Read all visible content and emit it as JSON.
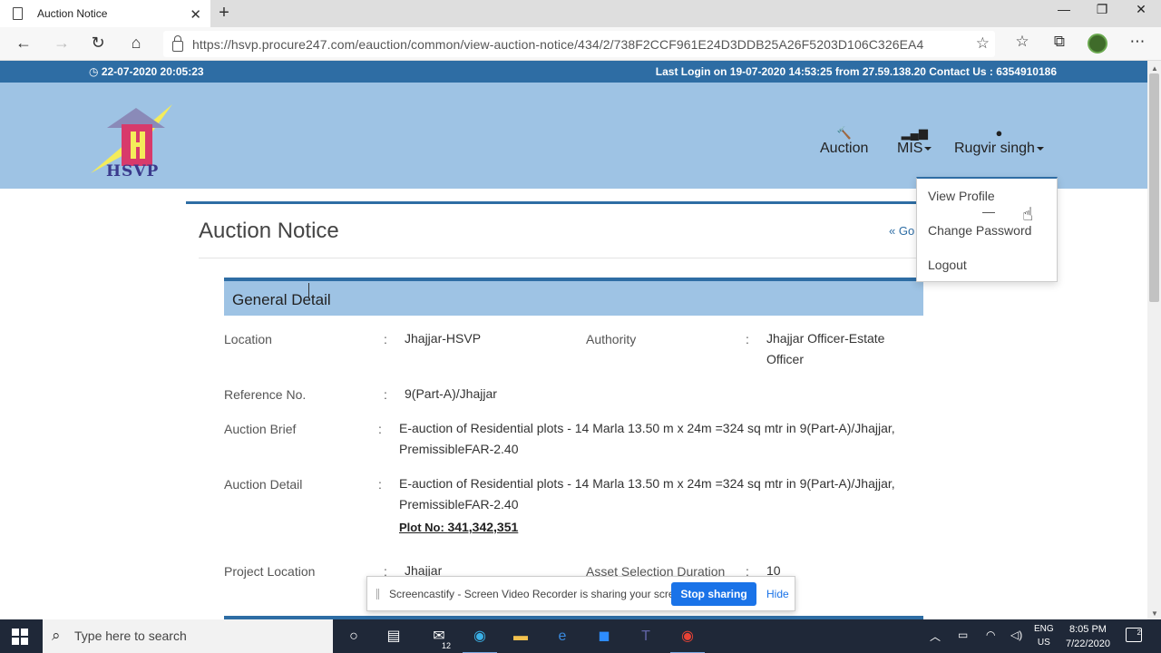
{
  "browser": {
    "tab_title": "Auction Notice",
    "new_tab_glyph": "+",
    "url": "https://hsvp.procure247.com/eauction/common/view-auction-notice/434/2/738F2CCF961E24D3DDB25A26F5203D106C326EA4",
    "icons": [
      "back-icon",
      "forward-icon",
      "refresh-icon",
      "home-icon",
      "lock-icon",
      "favorite-star-icon",
      "favorites-icon",
      "collections-icon",
      "profile-avatar",
      "more-icon"
    ]
  },
  "site": {
    "datetime": "22-07-2020 20:05:23",
    "last_login": "Last Login on 19-07-2020 14:53:25 from 27.59.138.20 Contact Us : 6354910186",
    "logo_text": "HSVP",
    "nav": {
      "auction": "Auction",
      "mis": "MIS",
      "user": "Rugvir singh"
    },
    "dropdown": {
      "view_profile": "View Profile",
      "change_password": "Change Password",
      "logout": "Logout"
    }
  },
  "page": {
    "title": "Auction Notice",
    "go_back": "« Go",
    "section_title": "General Detail",
    "colon": ":",
    "fields": {
      "location_label": "Location",
      "location_value": "Jhajjar-HSVP",
      "authority_label": "Authority",
      "authority_value_line1": "Jhajjar Officer-Estate",
      "authority_value_line2": "Officer",
      "reference_label": "Reference No.",
      "reference_value": "9(Part-A)/Jhajjar",
      "brief_label": "Auction Brief",
      "brief_line1": "E-auction of Residential plots - 14 Marla 13.50 m x 24m =324 sq mtr in 9(Part-A)/Jhajjar,",
      "brief_line2": "PremissibleFAR-2.40",
      "detail_label": "Auction Detail",
      "detail_line1": "E-auction of Residential plots - 14 Marla 13.50 m x 24m =324 sq mtr in 9(Part-A)/Jhajjar,",
      "detail_line2": "PremissibleFAR-2.40",
      "plot_prefix": "Plot No: ",
      "plot_numbers": "341,342,351",
      "project_location_label": "Project Location",
      "project_location_value": "Jhajjar",
      "asset_duration_label": "Asset Selection Duration",
      "asset_duration_value": "10"
    }
  },
  "share_banner": {
    "message": "Screencastify - Screen Video Recorder is sharing your screen.",
    "stop": "Stop sharing",
    "hide": "Hide"
  },
  "taskbar": {
    "search_placeholder": "Type here to search",
    "mail_badge": "12",
    "lang_line1": "ENG",
    "lang_line2": "US",
    "time": "8:05 PM",
    "date": "7/22/2020",
    "notification_count": "2"
  },
  "colors": {
    "accent": "#2e6da4",
    "header_bg": "#9ec3e4",
    "taskbar": "#1f2838",
    "stop_button": "#1a73e8"
  }
}
